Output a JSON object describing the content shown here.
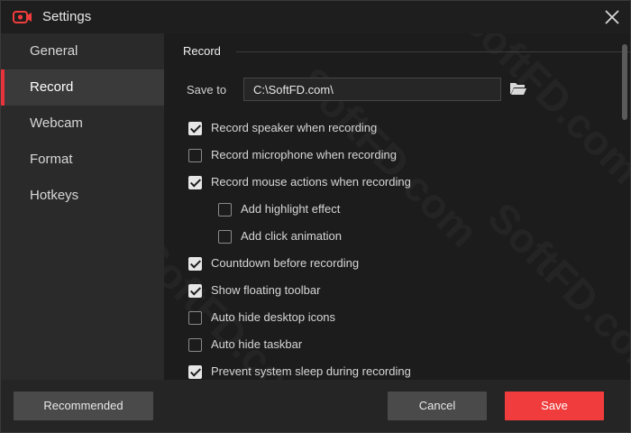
{
  "window": {
    "title": "Settings",
    "icons": {
      "app": "record-camera-icon",
      "close": "close-icon"
    }
  },
  "sidebar": {
    "items": [
      {
        "label": "General",
        "active": false
      },
      {
        "label": "Record",
        "active": true
      },
      {
        "label": "Webcam",
        "active": false
      },
      {
        "label": "Format",
        "active": false
      },
      {
        "label": "Hotkeys",
        "active": false
      }
    ]
  },
  "record": {
    "section_title": "Record",
    "save_to": {
      "label": "Save to",
      "value": "C:\\SoftFD.com\\",
      "icon": "folder-icon"
    },
    "options": [
      {
        "label": "Record speaker when recording",
        "checked": true
      },
      {
        "label": "Record microphone when recording",
        "checked": false
      },
      {
        "label": "Record mouse actions when recording",
        "checked": true
      },
      {
        "label": "Add highlight effect",
        "checked": false
      },
      {
        "label": "Add click animation",
        "checked": false
      },
      {
        "label": "Countdown before recording",
        "checked": true
      },
      {
        "label": "Show floating toolbar",
        "checked": true
      },
      {
        "label": "Auto hide desktop icons",
        "checked": false
      },
      {
        "label": "Auto hide taskbar",
        "checked": false
      },
      {
        "label": "Prevent system sleep during recording",
        "checked": true
      }
    ]
  },
  "footer": {
    "recommended_label": "Recommended",
    "cancel_label": "Cancel",
    "save_label": "Save"
  },
  "watermark": "SoftFD.com",
  "colors": {
    "accent": "#f03c3c",
    "active_indicator": "#e8323c"
  }
}
